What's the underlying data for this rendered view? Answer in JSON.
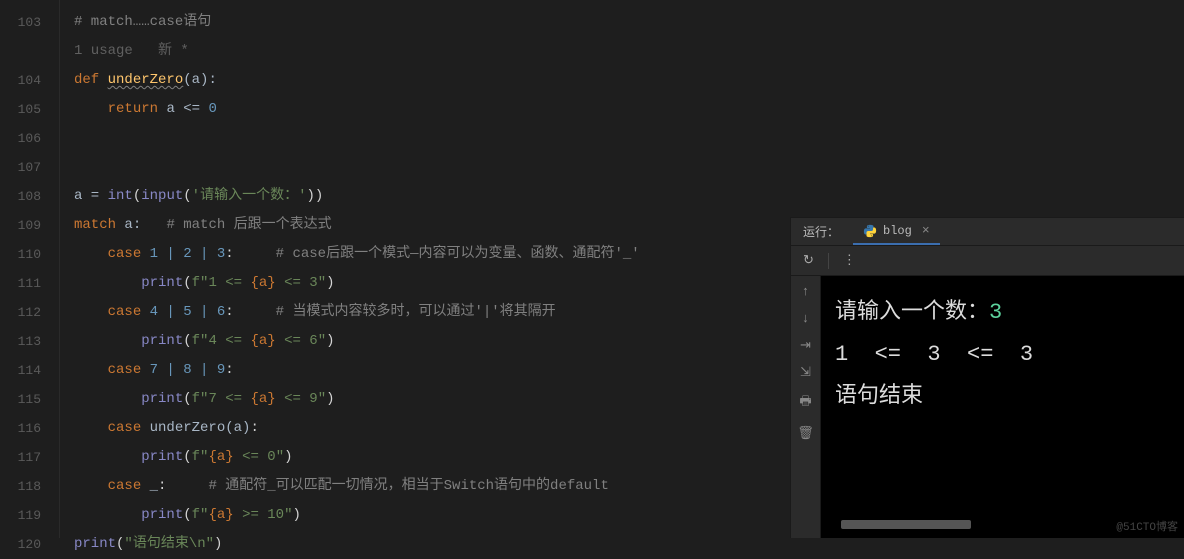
{
  "gutter": [
    "103",
    "",
    "104",
    "105",
    "106",
    "107",
    "108",
    "109",
    "110",
    "111",
    "112",
    "113",
    "114",
    "115",
    "116",
    "117",
    "118",
    "119",
    "120"
  ],
  "hints": {
    "usage": "1 usage",
    "author": "新 *"
  },
  "code": {
    "l103": "# match……case语句",
    "def": "def",
    "fn": "underZero",
    "p_open": "(a):",
    "ret": "return",
    "ret_expr_var": "a",
    "ret_op": " <= ",
    "ret_num": "0",
    "assign_var": "a",
    "eq": " = ",
    "int_fn": "int",
    "input_fn": "input",
    "input_str": "'请输入一个数：'",
    "match": "match",
    "match_var": "a:",
    "match_cmt": "   # match 后跟一个表达式",
    "case": "case",
    "c1": "1 | 2 | 3",
    "c1_cmt": "     # case后跟一个模式—内容可以为变量、函数、通配符'_'",
    "print": "print",
    "f_q": "f\"",
    "q": "\"",
    "p1a": "1 <= ",
    "fa": "{a}",
    "p1b": " <= 3",
    "c2": "4 | 5 | 6",
    "c2_cmt": "     # 当模式内容较多时，可以通过'|'将其隔开",
    "p2a": "4 <= ",
    "p2b": " <= 6",
    "c3": "7 | 8 | 9",
    "p3a": "7 <= ",
    "p3b": " <= 9",
    "c4_fn": "underZero(a)",
    "p4b": " <= 0",
    "c5": "_",
    "c5_cmt": "     # 通配符_可以匹配一切情况，相当于Switch语句中的default",
    "p5b": " >= 10",
    "final_str": "\"语句结束\\n\""
  },
  "run": {
    "title": "运行：",
    "tab": "blog",
    "console": {
      "l1_prompt": "请输入一个数：",
      "l1_in": "3",
      "l2": "1  <=  3  <=  3",
      "l3": "语句结束"
    }
  },
  "watermark": "@51CTO博客"
}
